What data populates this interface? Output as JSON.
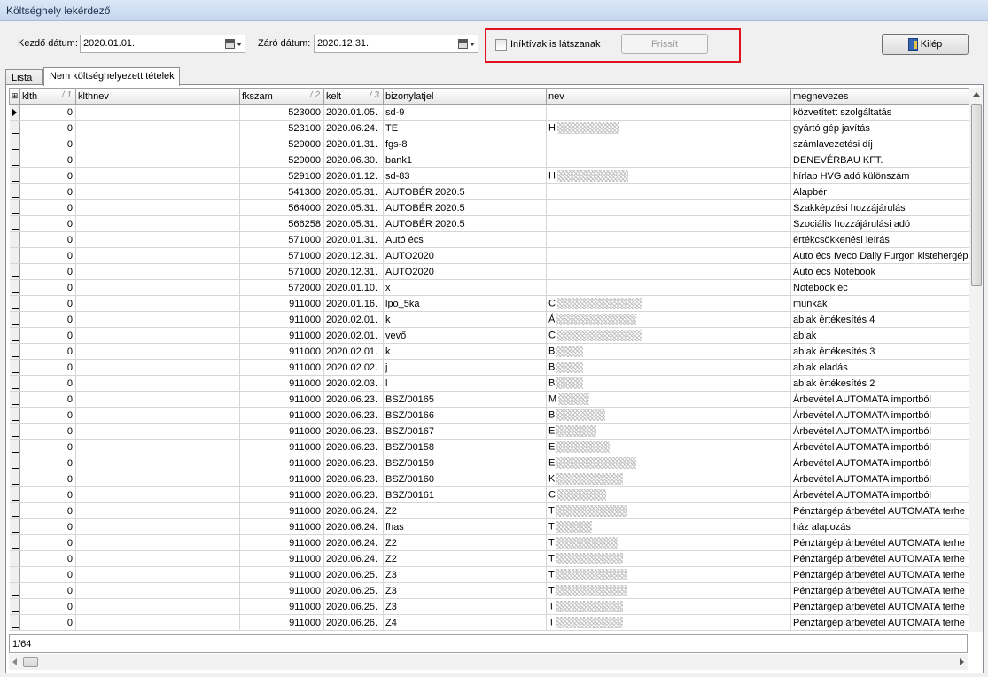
{
  "window": {
    "title": "Költséghely lekérdező"
  },
  "filters": {
    "start_label": "Kezdő dátum:",
    "start_value": "2020.01.01.",
    "end_label": "Záró dátum:",
    "end_value": "2020.12.31.",
    "inactive_label": "Iníktívak is látszanak",
    "inactive_checked": false,
    "refresh_label": "Frissít",
    "exit_label": "Kilép"
  },
  "tabs": [
    {
      "label": "Lista",
      "active": false
    },
    {
      "label": "Nem költséghelyezett tételek",
      "active": true
    }
  ],
  "grid": {
    "columns": [
      {
        "label": "klth",
        "sort": "/ 1"
      },
      {
        "label": "klthnev",
        "sort": ""
      },
      {
        "label": "fkszam",
        "sort": "/ 2"
      },
      {
        "label": "kelt",
        "sort": "/ 3"
      },
      {
        "label": "bizonylatjel",
        "sort": ""
      },
      {
        "label": "nev",
        "sort": ""
      },
      {
        "label": "megnevezes",
        "sort": ""
      }
    ],
    "rows": [
      {
        "klth": "0",
        "klthnev": "",
        "fkszam": "523000",
        "kelt": "2020.01.05.",
        "bizonylatjel": "sd-9",
        "nev": "",
        "megnevezes": "közvetített szolgáltatás"
      },
      {
        "klth": "0",
        "klthnev": "",
        "fkszam": "523100",
        "kelt": "2020.06.24.",
        "bizonylatjel": "TE",
        "nev": "H",
        "megnevezes": "gyártó gép javítás"
      },
      {
        "klth": "0",
        "klthnev": "",
        "fkszam": "529000",
        "kelt": "2020.01.31.",
        "bizonylatjel": "fgs-8",
        "nev": "",
        "megnevezes": "számlavezetési díj"
      },
      {
        "klth": "0",
        "klthnev": "",
        "fkszam": "529000",
        "kelt": "2020.06.30.",
        "bizonylatjel": "bank1",
        "nev": "",
        "megnevezes": "DENEVÉRBAU KFT."
      },
      {
        "klth": "0",
        "klthnev": "",
        "fkszam": "529100",
        "kelt": "2020.01.12.",
        "bizonylatjel": "sd-83",
        "nev": "H",
        "megnevezes": "hírlap HVG adó különszám"
      },
      {
        "klth": "0",
        "klthnev": "",
        "fkszam": "541300",
        "kelt": "2020.05.31.",
        "bizonylatjel": "AUTOBÉR 2020.5",
        "nev": "",
        "megnevezes": "Alapbér"
      },
      {
        "klth": "0",
        "klthnev": "",
        "fkszam": "564000",
        "kelt": "2020.05.31.",
        "bizonylatjel": "AUTOBÉR 2020.5",
        "nev": "",
        "megnevezes": "Szakképzési hozzájárulás"
      },
      {
        "klth": "0",
        "klthnev": "",
        "fkszam": "566258",
        "kelt": "2020.05.31.",
        "bizonylatjel": "AUTOBÉR 2020.5",
        "nev": "",
        "megnevezes": "Szociális hozzájárulási adó"
      },
      {
        "klth": "0",
        "klthnev": "",
        "fkszam": "571000",
        "kelt": "2020.01.31.",
        "bizonylatjel": "Autó écs",
        "nev": "",
        "megnevezes": "értékcsökkenési leírás"
      },
      {
        "klth": "0",
        "klthnev": "",
        "fkszam": "571000",
        "kelt": "2020.12.31.",
        "bizonylatjel": "AUTO2020",
        "nev": "",
        "megnevezes": "Auto écs Iveco Daily Furgon kistehergép"
      },
      {
        "klth": "0",
        "klthnev": "",
        "fkszam": "571000",
        "kelt": "2020.12.31.",
        "bizonylatjel": "AUTO2020",
        "nev": "",
        "megnevezes": "Auto écs Notebook"
      },
      {
        "klth": "0",
        "klthnev": "",
        "fkszam": "572000",
        "kelt": "2020.01.10.",
        "bizonylatjel": "x",
        "nev": "",
        "megnevezes": "Notebook éc"
      },
      {
        "klth": "0",
        "klthnev": "",
        "fkszam": "911000",
        "kelt": "2020.01.16.",
        "bizonylatjel": "lpo_5ka",
        "nev": "C",
        "megnevezes": "munkák"
      },
      {
        "klth": "0",
        "klthnev": "",
        "fkszam": "911000",
        "kelt": "2020.02.01.",
        "bizonylatjel": "k",
        "nev": "Á",
        "megnevezes": "ablak értékesítés 4"
      },
      {
        "klth": "0",
        "klthnev": "",
        "fkszam": "911000",
        "kelt": "2020.02.01.",
        "bizonylatjel": "vevő",
        "nev": "C",
        "megnevezes": "ablak"
      },
      {
        "klth": "0",
        "klthnev": "",
        "fkszam": "911000",
        "kelt": "2020.02.01.",
        "bizonylatjel": "k",
        "nev": "B",
        "megnevezes": "ablak értékesítés 3"
      },
      {
        "klth": "0",
        "klthnev": "",
        "fkszam": "911000",
        "kelt": "2020.02.02.",
        "bizonylatjel": "j",
        "nev": "B",
        "megnevezes": "ablak eladás"
      },
      {
        "klth": "0",
        "klthnev": "",
        "fkszam": "911000",
        "kelt": "2020.02.03.",
        "bizonylatjel": "l",
        "nev": "B",
        "megnevezes": "ablak értékesítés 2"
      },
      {
        "klth": "0",
        "klthnev": "",
        "fkszam": "911000",
        "kelt": "2020.06.23.",
        "bizonylatjel": "BSZ/00165",
        "nev": "M",
        "megnevezes": "Árbevétel AUTOMATA importból"
      },
      {
        "klth": "0",
        "klthnev": "",
        "fkszam": "911000",
        "kelt": "2020.06.23.",
        "bizonylatjel": "BSZ/00166",
        "nev": "B",
        "megnevezes": "Árbevétel AUTOMATA importból"
      },
      {
        "klth": "0",
        "klthnev": "",
        "fkszam": "911000",
        "kelt": "2020.06.23.",
        "bizonylatjel": "BSZ/00167",
        "nev": "E",
        "megnevezes": "Árbevétel AUTOMATA importból"
      },
      {
        "klth": "0",
        "klthnev": "",
        "fkszam": "911000",
        "kelt": "2020.06.23.",
        "bizonylatjel": "BSZ/00158",
        "nev": "E",
        "megnevezes": "Árbevétel AUTOMATA importból"
      },
      {
        "klth": "0",
        "klthnev": "",
        "fkszam": "911000",
        "kelt": "2020.06.23.",
        "bizonylatjel": "BSZ/00159",
        "nev": "E",
        "megnevezes": "Árbevétel AUTOMATA importból"
      },
      {
        "klth": "0",
        "klthnev": "",
        "fkszam": "911000",
        "kelt": "2020.06.23.",
        "bizonylatjel": "BSZ/00160",
        "nev": "K",
        "megnevezes": "Árbevétel AUTOMATA importból"
      },
      {
        "klth": "0",
        "klthnev": "",
        "fkszam": "911000",
        "kelt": "2020.06.23.",
        "bizonylatjel": "BSZ/00161",
        "nev": "C",
        "megnevezes": "Árbevétel AUTOMATA importból"
      },
      {
        "klth": "0",
        "klthnev": "",
        "fkszam": "911000",
        "kelt": "2020.06.24.",
        "bizonylatjel": "Z2",
        "nev": "T",
        "megnevezes": "Pénztárgép árbevétel AUTOMATA terhe"
      },
      {
        "klth": "0",
        "klthnev": "",
        "fkszam": "911000",
        "kelt": "2020.06.24.",
        "bizonylatjel": "fhas",
        "nev": "T",
        "megnevezes": "ház alapozás"
      },
      {
        "klth": "0",
        "klthnev": "",
        "fkszam": "911000",
        "kelt": "2020.06.24.",
        "bizonylatjel": "Z2",
        "nev": "T",
        "megnevezes": "Pénztárgép árbevétel AUTOMATA terhe"
      },
      {
        "klth": "0",
        "klthnev": "",
        "fkszam": "911000",
        "kelt": "2020.06.24.",
        "bizonylatjel": "Z2",
        "nev": "T",
        "megnevezes": "Pénztárgép árbevétel AUTOMATA terhe"
      },
      {
        "klth": "0",
        "klthnev": "",
        "fkszam": "911000",
        "kelt": "2020.06.25.",
        "bizonylatjel": "Z3",
        "nev": "T",
        "megnevezes": "Pénztárgép árbevétel AUTOMATA terhe"
      },
      {
        "klth": "0",
        "klthnev": "",
        "fkszam": "911000",
        "kelt": "2020.06.25.",
        "bizonylatjel": "Z3",
        "nev": "T",
        "megnevezes": "Pénztárgép árbevétel AUTOMATA terhe"
      },
      {
        "klth": "0",
        "klthnev": "",
        "fkszam": "911000",
        "kelt": "2020.06.25.",
        "bizonylatjel": "Z3",
        "nev": "T",
        "megnevezes": "Pénztárgép árbevétel AUTOMATA terhe"
      },
      {
        "klth": "0",
        "klthnev": "",
        "fkszam": "911000",
        "kelt": "2020.06.26.",
        "bizonylatjel": "Z4",
        "nev": "T",
        "megnevezes": "Pénztárgép árbevétel AUTOMATA terhe"
      }
    ],
    "record_counter": "1/64"
  },
  "colors": {
    "highlight_box": "#e0141e",
    "title_bar": "#c5d7ee"
  }
}
